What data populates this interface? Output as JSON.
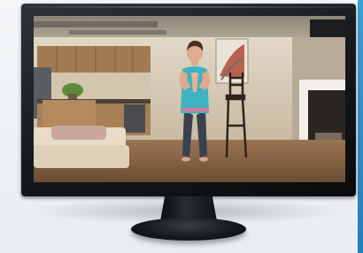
{
  "scene": {
    "description_icon": "monitor-icon",
    "colors": {
      "accent": "#2b8fd0",
      "bezel": "#1a1d20",
      "wall": "#d8cdb9",
      "floor": "#8a6848",
      "shirt": "#3fb3c4",
      "pants": "#3a4250"
    }
  }
}
